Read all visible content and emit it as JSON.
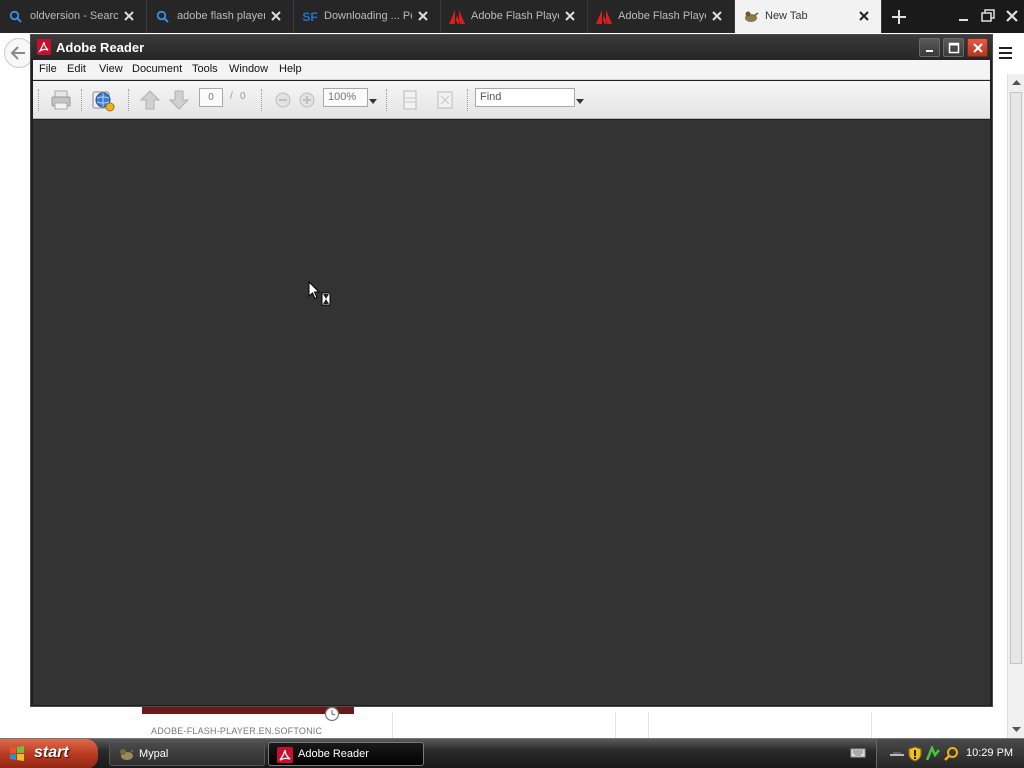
{
  "browser": {
    "tabs": [
      {
        "title": "oldversion - Search",
        "icon": "search-icon",
        "active": false
      },
      {
        "title": "adobe flash player",
        "icon": "search-icon",
        "active": false
      },
      {
        "title": "Downloading ... Po",
        "icon": "sourceforge-icon",
        "active": false
      },
      {
        "title": "Adobe Flash Player",
        "icon": "adobe-icon",
        "active": false
      },
      {
        "title": "Adobe Flash Player",
        "icon": "adobe-icon",
        "active": false
      },
      {
        "title": "New Tab",
        "icon": "new-tab-icon",
        "active": true
      }
    ],
    "page_footer_text": "ADOBE-FLASH-PLAYER.EN.SOFTONIC"
  },
  "reader": {
    "title": "Adobe Reader",
    "menu": [
      "File",
      "Edit",
      "View",
      "Document",
      "Tools",
      "Window",
      "Help"
    ],
    "toolbar": {
      "page_current": "0",
      "page_separator": "/",
      "page_total": "0",
      "zoom": "100%",
      "find_placeholder": "Find"
    }
  },
  "taskbar": {
    "start_label": "start",
    "items": [
      {
        "label": "Mypal",
        "icon": "mypal-icon",
        "active": false
      },
      {
        "label": "Adobe Reader",
        "icon": "adobe-reader-icon",
        "active": true
      }
    ],
    "clock": "10:29 PM"
  },
  "colors": {
    "reader_doc_bg": "#333333",
    "adobe_red": "#c8102e",
    "start_green": "#3a8a2a"
  }
}
